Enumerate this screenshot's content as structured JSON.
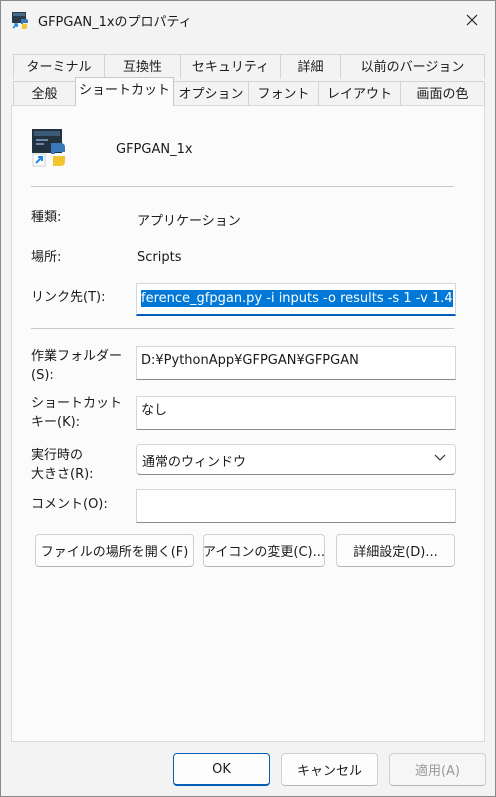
{
  "window": {
    "title": "GFPGAN_1xのプロパティ"
  },
  "tabs_row1": [
    "ターミナル",
    "互換性",
    "セキュリティ",
    "詳細",
    "以前のバージョン"
  ],
  "tabs_row2": [
    "全般",
    "ショートカット",
    "オプション",
    "フォント",
    "レイアウト",
    "画面の色"
  ],
  "active_tab": "ショートカット",
  "shortcut": {
    "name": "GFPGAN_1x",
    "type_label": "種類:",
    "type_value": "アプリケーション",
    "location_label": "場所:",
    "location_value": "Scripts",
    "target_label": "リンク先(T):",
    "target_value": "ference_gfpgan.py -i inputs -o results -s 1 -v 1.4",
    "startin_label_1": "作業フォルダー",
    "startin_label_2": "(S):",
    "startin_value": "D:¥PythonApp¥GFPGAN¥GFPGAN",
    "hotkey_label_1": "ショートカット",
    "hotkey_label_2": "キー(K):",
    "hotkey_value": "なし",
    "run_label_1": "実行時の",
    "run_label_2": "大きさ(R):",
    "run_value": "通常のウィンドウ",
    "comment_label": "コメント(O):",
    "comment_value": ""
  },
  "buttons": {
    "open_location": "ファイルの場所を開く(F)",
    "change_icon": "アイコンの変更(C)...",
    "advanced": "詳細設定(D)...",
    "ok": "OK",
    "cancel": "キャンセル",
    "apply": "適用(A)"
  },
  "colors": {
    "accent": "#005fb8",
    "selection": "#0078d7"
  }
}
